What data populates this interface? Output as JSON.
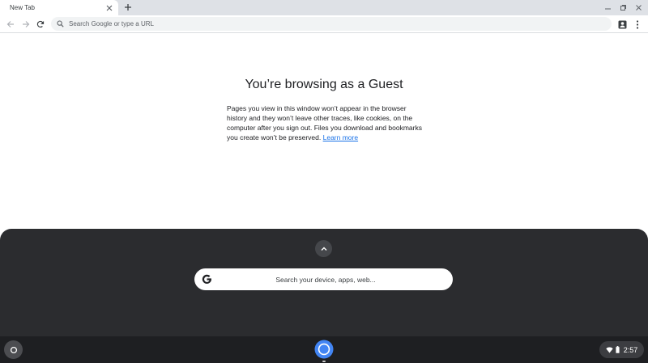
{
  "browser": {
    "tab": {
      "title": "New Tab"
    },
    "omnibox": {
      "placeholder": "Search Google or type a URL"
    }
  },
  "guest_page": {
    "title": "You’re browsing as a Guest",
    "description": "Pages you view in this window won’t appear in the browser history and they won’t leave other traces, like cookies, on the computer after you sign out. Files you download and bookmarks you create won’t be preserved.",
    "learn_more_label": "Learn more",
    "link_color": "#1a73e8"
  },
  "launcher": {
    "search_placeholder": "Search your device, apps, web..."
  },
  "shelf": {
    "status": {
      "time": "2:57"
    }
  },
  "icons": [
    "close-icon",
    "plus-icon",
    "minimize-icon",
    "restore-icon",
    "window-close-icon",
    "back-arrow-icon",
    "forward-arrow-icon",
    "reload-icon",
    "search-icon",
    "guest-account-icon",
    "more-vert-icon",
    "chevron-up-icon",
    "google-g-icon",
    "launcher-circle-icon",
    "chrome-icon",
    "wifi-icon",
    "battery-icon"
  ],
  "colors": {
    "tabstrip": "#dee1e6",
    "launcher_bg": "#2b2c2f",
    "shelf_bg": "#1e1f22",
    "chrome_blue": "#4285f4"
  }
}
